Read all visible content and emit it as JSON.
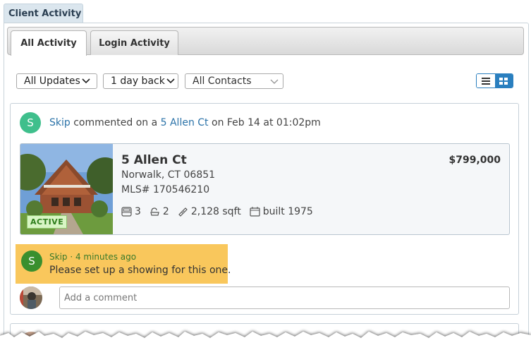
{
  "panel": {
    "title": "Client Activity"
  },
  "tabs": [
    {
      "label": "All Activity",
      "active": true
    },
    {
      "label": "Login Activity",
      "active": false
    }
  ],
  "filters": {
    "updates": "All Updates",
    "period": "1 day back",
    "contacts": "All Contacts"
  },
  "view_toggle": {
    "list_icon": "list-icon",
    "grid_icon": "grid-icon",
    "selected": "grid"
  },
  "activity": {
    "avatar_letter": "S",
    "user": "Skip",
    "action": "commented on a",
    "property_link": "5 Allen Ct",
    "date_text": "on Feb 14 at 01:02pm"
  },
  "listing": {
    "address": "5 Allen Ct",
    "city": "Norwalk, CT 06851",
    "mls": "MLS# 170546210",
    "price": "$799,000",
    "status": "ACTIVE",
    "beds": "3",
    "baths": "2",
    "sqft": "2,128 sqft",
    "built": "built 1975"
  },
  "comment": {
    "avatar_letter": "S",
    "meta": "Skip · 4 minutes ago",
    "text": "Please set up a showing for this one."
  },
  "new_comment": {
    "placeholder": "Add a comment"
  },
  "colors": {
    "accent": "#2a7fbf",
    "avatar_green": "#3fbf8c",
    "comment_highlight": "#f9c75c",
    "active_badge": "#d8f5c4"
  }
}
